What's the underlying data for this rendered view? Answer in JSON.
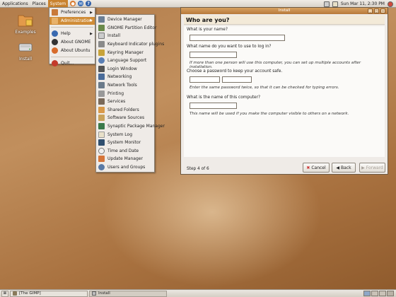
{
  "top_panel": {
    "menus": [
      "Applications",
      "Places",
      "System"
    ],
    "clock": "Sun Mar 11,  2:30 PM"
  },
  "desktop": {
    "icons": [
      {
        "label": "Examples"
      },
      {
        "label": "Install"
      }
    ]
  },
  "system_menu": {
    "items": [
      "Preferences",
      "Administration",
      "Help",
      "About GNOME",
      "About Ubuntu",
      "Quit..."
    ]
  },
  "admin_menu": {
    "items": [
      "Device Manager",
      "GNOME Partition Editor",
      "Install",
      "Keyboard Indicator plugins",
      "Keyring Manager",
      "Language Support",
      "Login Window",
      "Networking",
      "Network Tools",
      "Printing",
      "Services",
      "Shared Folders",
      "Software Sources",
      "Synaptic Package Manager",
      "System Log",
      "System Monitor",
      "Time and Date",
      "Update Manager",
      "Users and Groups"
    ]
  },
  "dialog": {
    "window_title": "Install",
    "header": "Who are you?",
    "q_name": "What is your name?",
    "q_login": "What name do you want to use to log in?",
    "hint_login": "If more than one person will use this computer, you can set up multiple accounts after installation.",
    "q_password": "Choose a password to keep your account safe.",
    "hint_password": "Enter the same password twice, so that it can be checked for typing errors.",
    "q_computer": "What is the name of this computer?",
    "hint_computer": "This name will be used if you make the computer visible to others on a network.",
    "step": "Step 4 of 6",
    "cancel": "Cancel",
    "back": "Back",
    "forward": "Forward"
  },
  "bottom_panel": {
    "tasks": [
      "[The GIMP]",
      "Install"
    ]
  },
  "colors": {
    "accent": "#d08c36",
    "desktop": "#b27c4a"
  }
}
